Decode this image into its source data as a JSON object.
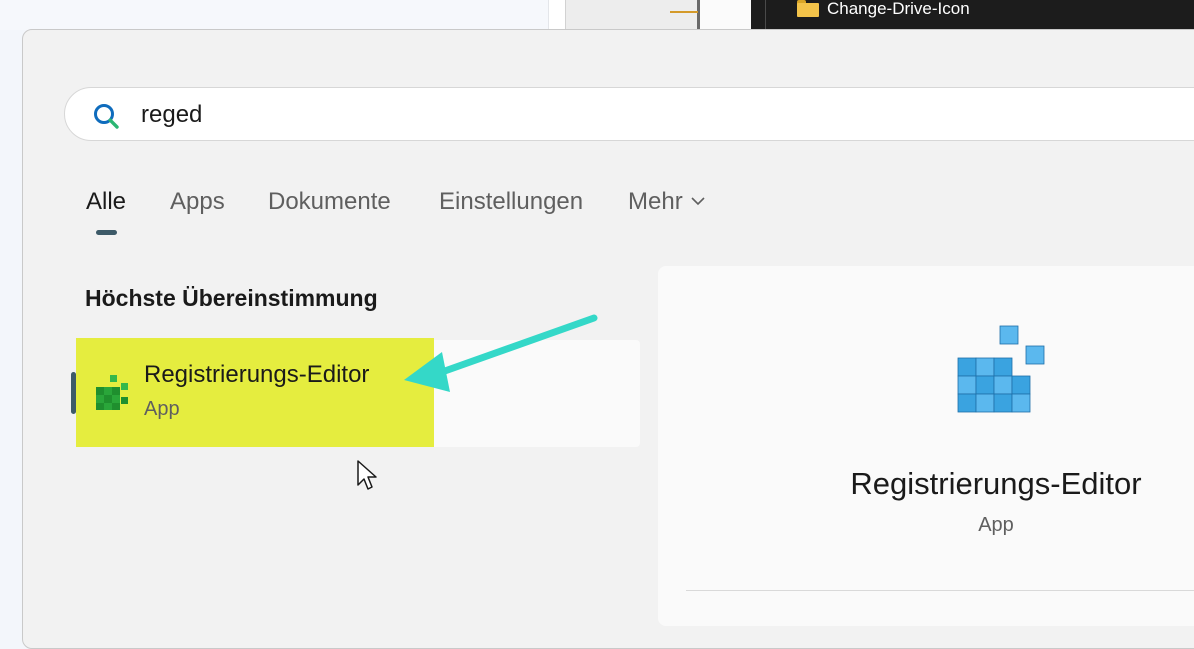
{
  "background": {
    "explorer_item_label": "Change-Drive-Icon",
    "explorer_item_icon": "folder-icon"
  },
  "search": {
    "query": "reged",
    "icon": "search-icon"
  },
  "tabs": [
    {
      "label": "Alle",
      "active": true
    },
    {
      "label": "Apps",
      "active": false
    },
    {
      "label": "Dokumente",
      "active": false
    },
    {
      "label": "Einstellungen",
      "active": false
    },
    {
      "label": "Mehr",
      "active": false,
      "icon": "chevron-down-icon"
    }
  ],
  "best_match": {
    "heading": "Höchste Übereinstimmung",
    "title": "Registrierungs-Editor",
    "subtitle": "App",
    "icon": "registry-editor-icon"
  },
  "details": {
    "title": "Registrierungs-Editor",
    "subtitle": "App",
    "icon": "registry-editor-icon"
  },
  "colors": {
    "highlight": "#e5ed3f",
    "arrow": "#34d8c8",
    "accent": "#3d5a68",
    "search_icon": "#0f6cbd"
  }
}
